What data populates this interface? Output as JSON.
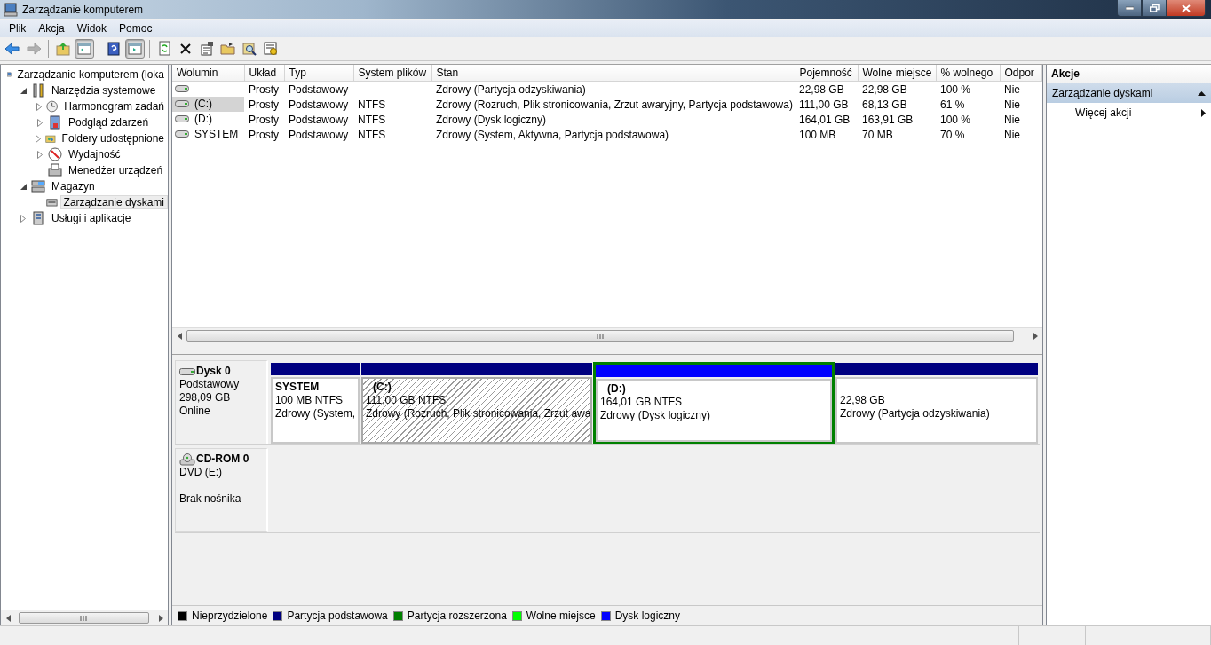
{
  "window": {
    "title": "Zarządzanie komputerem"
  },
  "menu": [
    "Plik",
    "Akcja",
    "Widok",
    "Pomoc"
  ],
  "toolbar": [
    {
      "disabled": false,
      "pressed": false
    },
    {
      "disabled": true,
      "pressed": false
    },
    {
      "disabled": false,
      "pressed": false
    },
    {
      "disabled": false,
      "pressed": true
    },
    {
      "disabled": false,
      "pressed": false
    },
    {
      "disabled": false,
      "pressed": true
    },
    {
      "disabled": false,
      "pressed": false
    },
    {
      "disabled": false,
      "pressed": false
    },
    {
      "disabled": false,
      "pressed": false
    },
    {
      "disabled": false,
      "pressed": false
    },
    {
      "disabled": false,
      "pressed": false
    },
    {
      "disabled": false,
      "pressed": false
    }
  ],
  "tree": [
    {
      "label": "Zarządzanie komputerem (loka",
      "selected": false,
      "children": [
        {
          "label": "Narzędzia systemowe",
          "expanded": true,
          "selected": false,
          "children": [
            {
              "label": "Harmonogram zadań",
              "expanded": false,
              "selected": false
            },
            {
              "label": "Podgląd zdarzeń",
              "expanded": false,
              "selected": false
            },
            {
              "label": "Foldery udostępnione",
              "expanded": false,
              "selected": false
            },
            {
              "label": "Wydajność",
              "expanded": false,
              "selected": false
            },
            {
              "label": "Menedżer urządzeń",
              "selected": false
            }
          ]
        },
        {
          "label": "Magazyn",
          "expanded": true,
          "selected": false,
          "children": [
            {
              "label": "Zarządzanie dyskami",
              "selected": true
            }
          ]
        },
        {
          "label": "Usługi i aplikacje",
          "expanded": false,
          "selected": false
        }
      ]
    }
  ],
  "table": {
    "columns": [
      "Wolumin",
      "Układ",
      "Typ",
      "System plików",
      "Stan",
      "Pojemność",
      "Wolne miejsce",
      "% wolnego",
      "Odpor"
    ],
    "rows": [
      {
        "selected": false,
        "cells": [
          "",
          "Prosty",
          "Podstawowy",
          "",
          "Zdrowy (Partycja odzyskiwania)",
          "22,98 GB",
          "22,98 GB",
          "100 %",
          "Nie"
        ]
      },
      {
        "selected": true,
        "cells": [
          "(C:)",
          "Prosty",
          "Podstawowy",
          "NTFS",
          "Zdrowy (Rozruch, Plik stronicowania, Zrzut awaryjny, Partycja podstawowa)",
          "111,00 GB",
          "68,13 GB",
          "61 %",
          "Nie"
        ]
      },
      {
        "selected": false,
        "cells": [
          "(D:)",
          "Prosty",
          "Podstawowy",
          "NTFS",
          "Zdrowy (Dysk logiczny)",
          "164,01 GB",
          "163,91 GB",
          "100 %",
          "Nie"
        ]
      },
      {
        "selected": false,
        "cells": [
          "SYSTEM",
          "Prosty",
          "Podstawowy",
          "NTFS",
          "Zdrowy (System, Aktywna, Partycja podstawowa)",
          "100 MB",
          "70 MB",
          "70 %",
          "Nie"
        ]
      }
    ]
  },
  "disks": [
    {
      "kind": "disk",
      "name": "Dysk 0",
      "type": "Podstawowy",
      "capacity": "298,09 GB",
      "status": "Online",
      "partitions": [
        {
          "name": "SYSTEM",
          "size": "100 MB NTFS",
          "status": "Zdrowy (System,",
          "color": "#000080",
          "selected": false,
          "extended": false
        },
        {
          "name": "(C:)",
          "size": "111,00 GB NTFS",
          "status": "Zdrowy (Rozruch, Plik stronicowania, Zrzut awa",
          "color": "#000080",
          "selected": true,
          "extended": false
        },
        {
          "name": "(D:)",
          "size": "164,01 GB NTFS",
          "status": "Zdrowy (Dysk logiczny)",
          "color": "#0000ff",
          "selected": false,
          "extended": true
        },
        {
          "size": "22,98 GB",
          "status": "Zdrowy (Partycja odzyskiwania)",
          "color": "#000080",
          "selected": false,
          "extended": false
        }
      ]
    },
    {
      "kind": "cdrom",
      "name": "CD-ROM 0",
      "type": "DVD (E:)",
      "status": "Brak nośnika"
    }
  ],
  "legend": [
    {
      "label": "Nieprzydzielone",
      "color": "#000000"
    },
    {
      "label": "Partycja podstawowa",
      "color": "#000080"
    },
    {
      "label": "Partycja rozszerzona",
      "color": "#008000"
    },
    {
      "label": "Wolne miejsce",
      "color": "#00ff00"
    },
    {
      "label": "Dysk logiczny",
      "color": "#0000ff"
    }
  ],
  "actions": {
    "title": "Akcje",
    "section": {
      "label": "Zarządzanie dyskami",
      "expanded": true
    },
    "items": [
      "Więcej akcji"
    ]
  }
}
